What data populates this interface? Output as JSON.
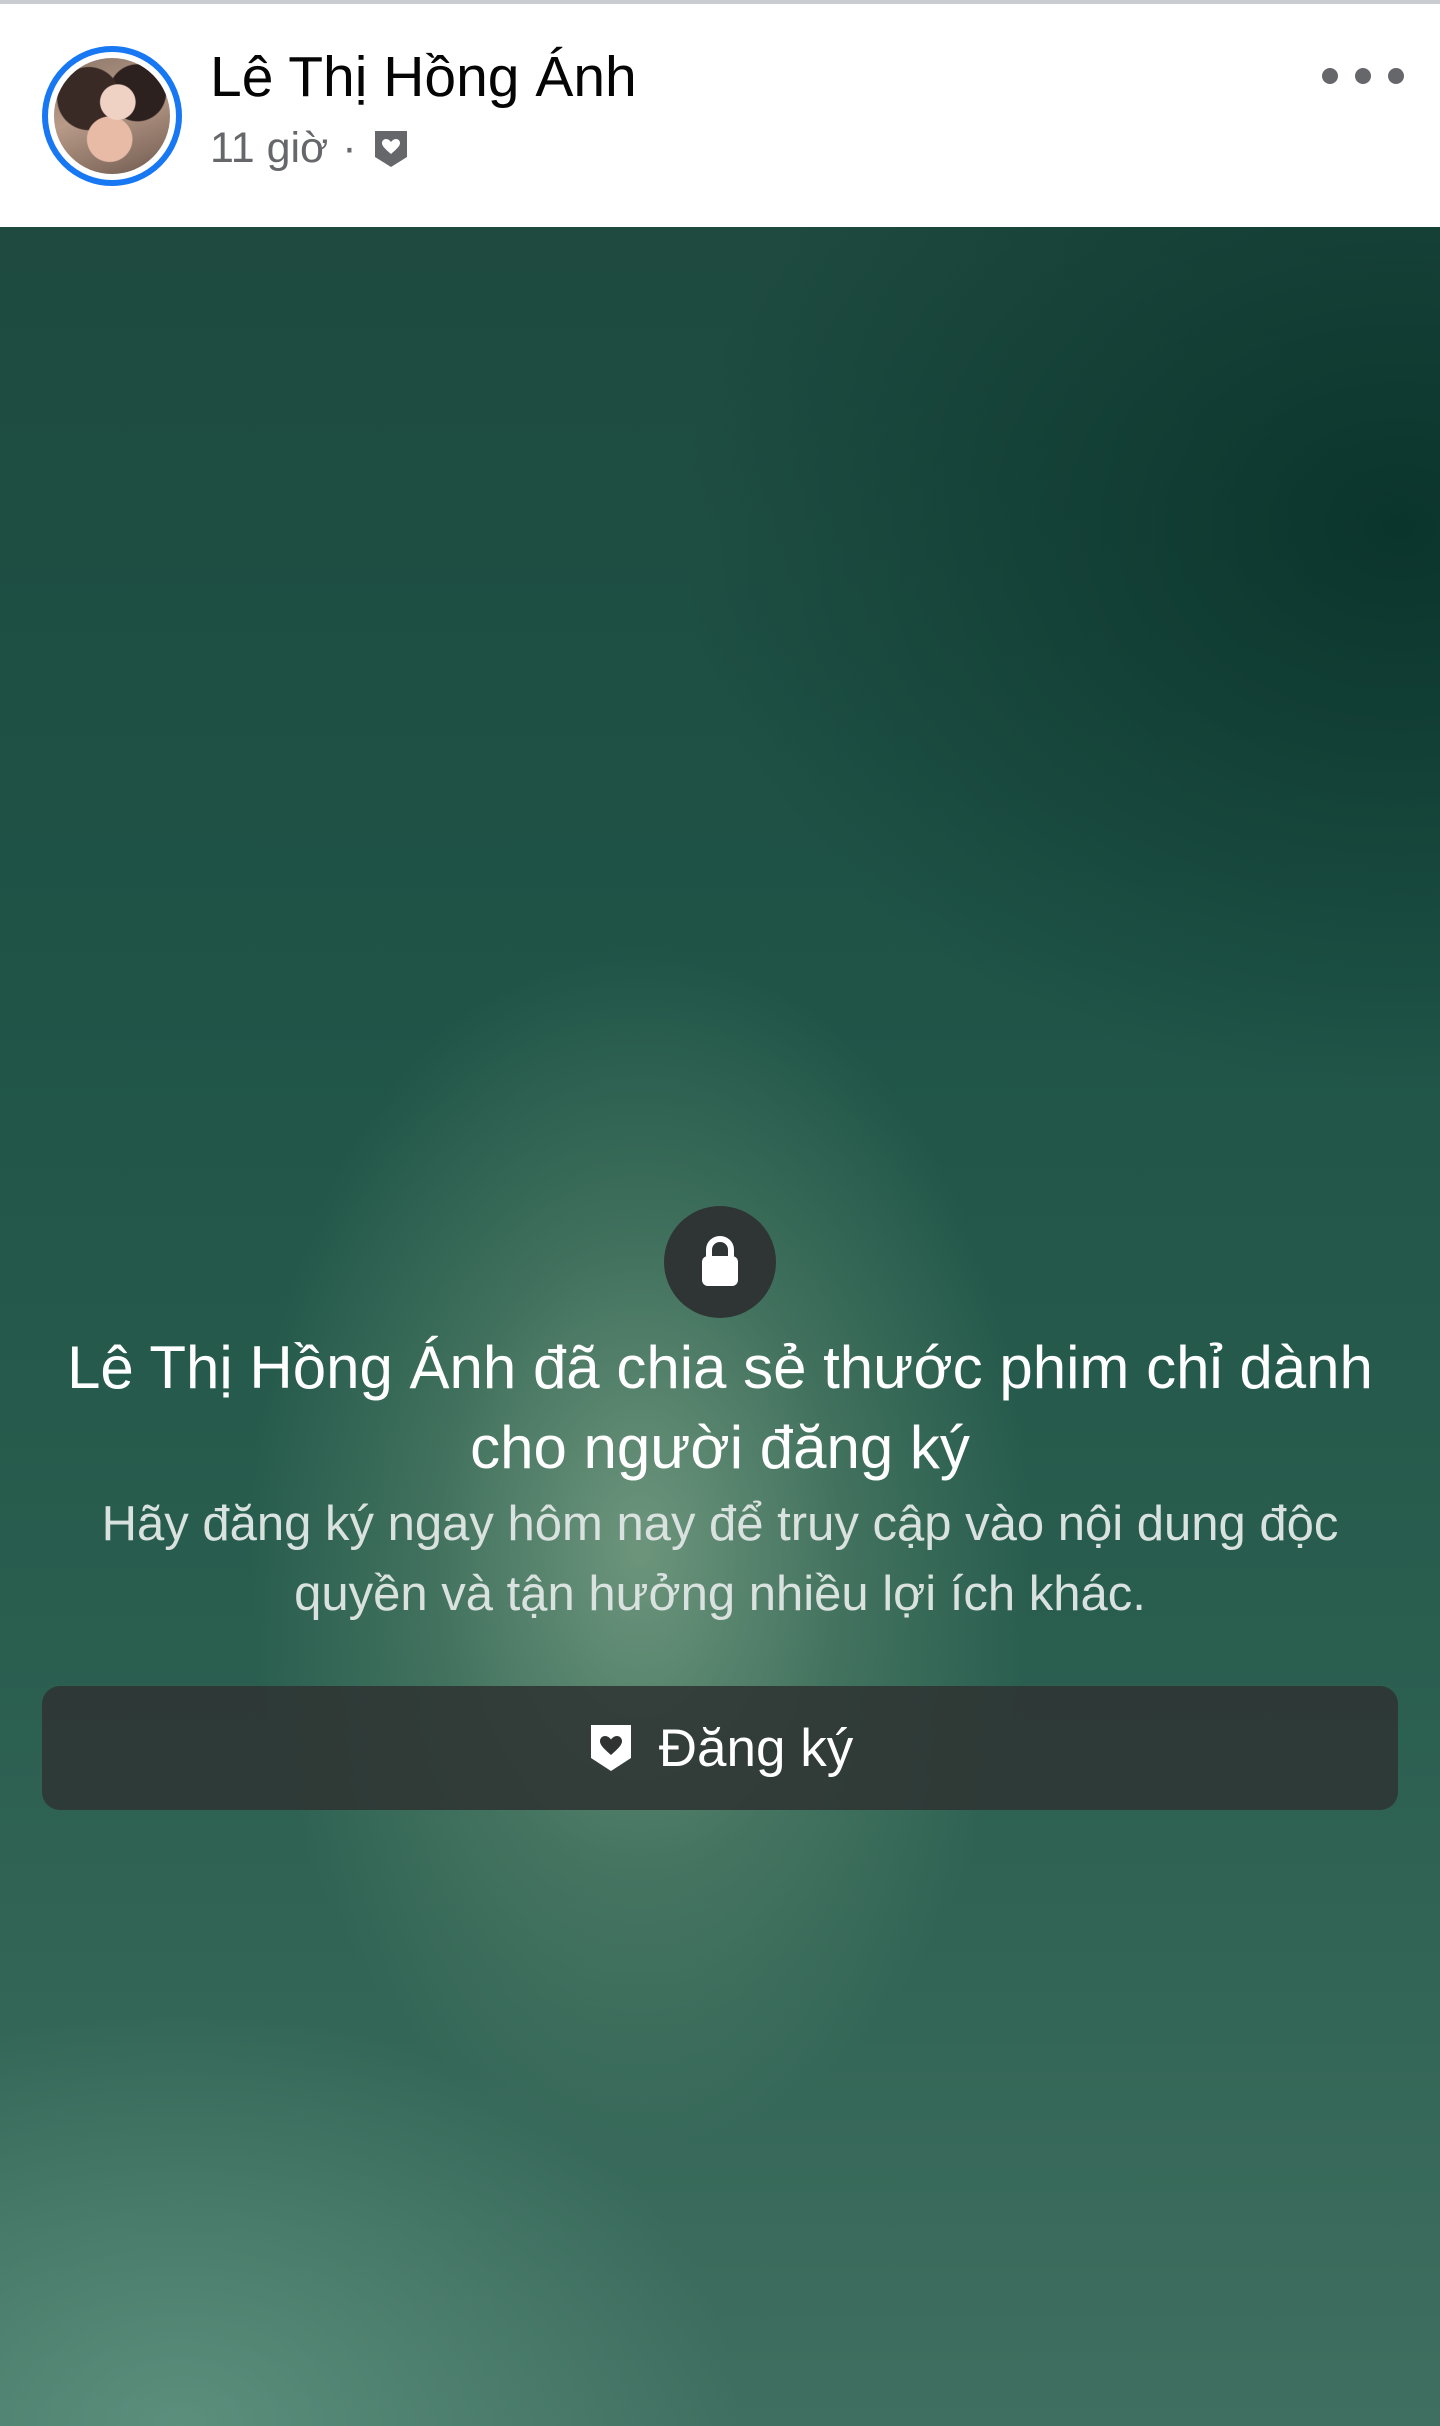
{
  "post": {
    "author_name": "Lê Thị Hồng Ánh",
    "time": "11 giờ",
    "separator": "·",
    "audience_icon": "subscriber-badge-icon",
    "more_icon": "more-options-icon"
  },
  "locked": {
    "lock_icon": "lock-icon",
    "title": "Lê Thị Hồng Ánh đã chia sẻ thước phim chỉ dành cho người đăng ký",
    "subtitle": "Hãy đăng ký ngay hôm nay để truy cập vào nội dung độc quyền và tận hưởng nhiều lợi ích khác.",
    "button_icon": "subscriber-badge-icon",
    "button_label": "Đăng ký"
  },
  "colors": {
    "accent": "#1877f2",
    "name_text": "#050505",
    "meta_text": "#65676b",
    "media_base": "#1f5447",
    "button_bg": "#2f3433"
  }
}
